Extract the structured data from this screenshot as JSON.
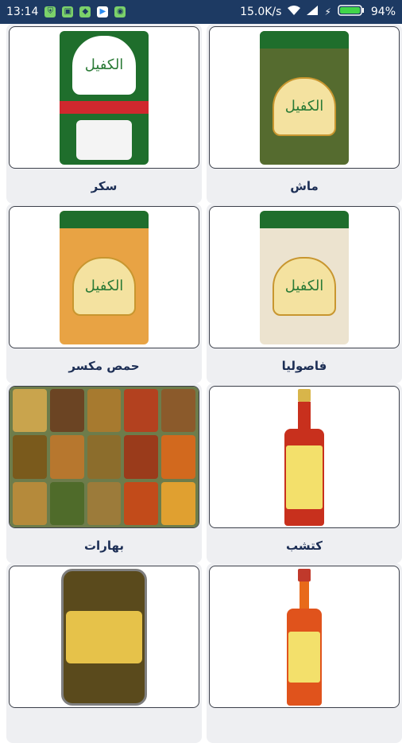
{
  "status_bar": {
    "time": "13:14",
    "speed": "15.0K/s",
    "battery": "94%"
  },
  "products": [
    {
      "name": "ماش",
      "image": "mung-bean-package"
    },
    {
      "name": "سكر",
      "image": "sugar-package"
    },
    {
      "name": "فاصوليا",
      "image": "white-bean-package"
    },
    {
      "name": "حمص مكسر",
      "image": "split-chickpea-package"
    },
    {
      "name": "كتشب",
      "image": "ketchup-bottle"
    },
    {
      "name": "بهارات",
      "image": "spice-jars"
    },
    {
      "name": "",
      "image": "hot-sauce-bottle"
    },
    {
      "name": "",
      "image": "pickle-jar"
    }
  ],
  "brand_text": "الكفيل",
  "colors": {
    "status_bar": "#1d3a63",
    "label_text": "#1c2e55",
    "tile_bg": "#eeeff2"
  }
}
